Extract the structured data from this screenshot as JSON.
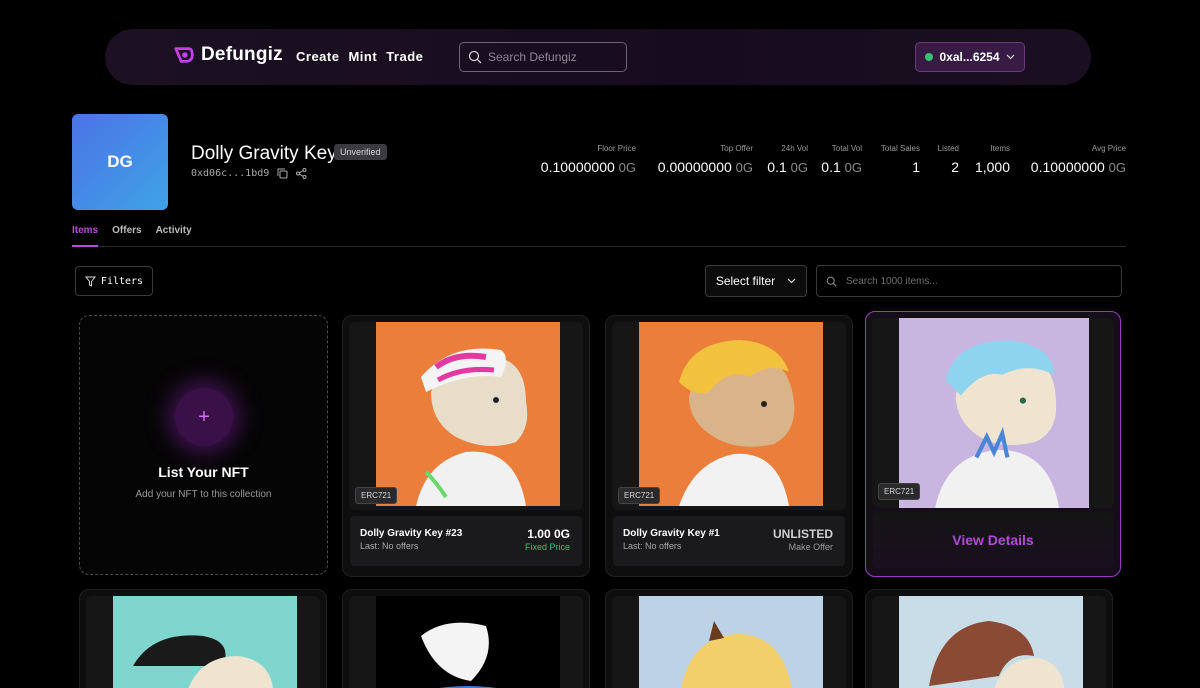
{
  "nav": {
    "brand": "Defungiz",
    "links": [
      "Create",
      "Mint",
      "Trade"
    ],
    "search_placeholder": "Search Defungiz",
    "wallet": "0xal...6254"
  },
  "collection": {
    "avatar": "DG",
    "name": "Dolly Gravity Key",
    "badge": "Unverified",
    "address": "0xd06c...1bd9"
  },
  "stats": [
    {
      "label": "Floor Price",
      "value": "0.10000000",
      "unit": "0G"
    },
    {
      "label": "Top Offer",
      "value": "0.00000000",
      "unit": "0G"
    },
    {
      "label": "24h Vol",
      "value": "0.1",
      "unit": "0G"
    },
    {
      "label": "Total Vol",
      "value": "0.1",
      "unit": "0G"
    },
    {
      "label": "Total Sales",
      "value": "1",
      "unit": ""
    },
    {
      "label": "Listed",
      "value": "2",
      "unit": ""
    },
    {
      "label": "Items",
      "value": "1,000",
      "unit": ""
    },
    {
      "label": "Avg Price",
      "value": "0.10000000",
      "unit": "0G"
    }
  ],
  "tabs": [
    "Items",
    "Offers",
    "Activity"
  ],
  "filters": {
    "filters_label": "Filters",
    "select_label": "Select filter",
    "search_placeholder": "Search 1000 items..."
  },
  "list_card": {
    "title": "List Your NFT",
    "subtitle": "Add your NFT to this collection"
  },
  "cards": [
    {
      "standard": "ERC721",
      "name": "Dolly Gravity Key #23",
      "last": "Last: No offers",
      "price": "1.00 0G",
      "price_type": "Fixed Price",
      "bg": "#ea7e3a"
    },
    {
      "standard": "ERC721",
      "name": "Dolly Gravity Key #1",
      "last": "Last: No offers",
      "price": "UNLISTED",
      "price_type": "Make Offer",
      "bg": "#ea7e3a"
    },
    {
      "standard": "ERC721",
      "action": "View Details",
      "bg": "#c8b6e0"
    }
  ],
  "row2_bgs": [
    "#7fd6cf",
    "#000000",
    "#bcd2e6",
    "#c9dde8"
  ],
  "colors": {
    "accent": "#b64bd9",
    "green": "#3ec46d",
    "wallet_bg": "#371b44"
  }
}
